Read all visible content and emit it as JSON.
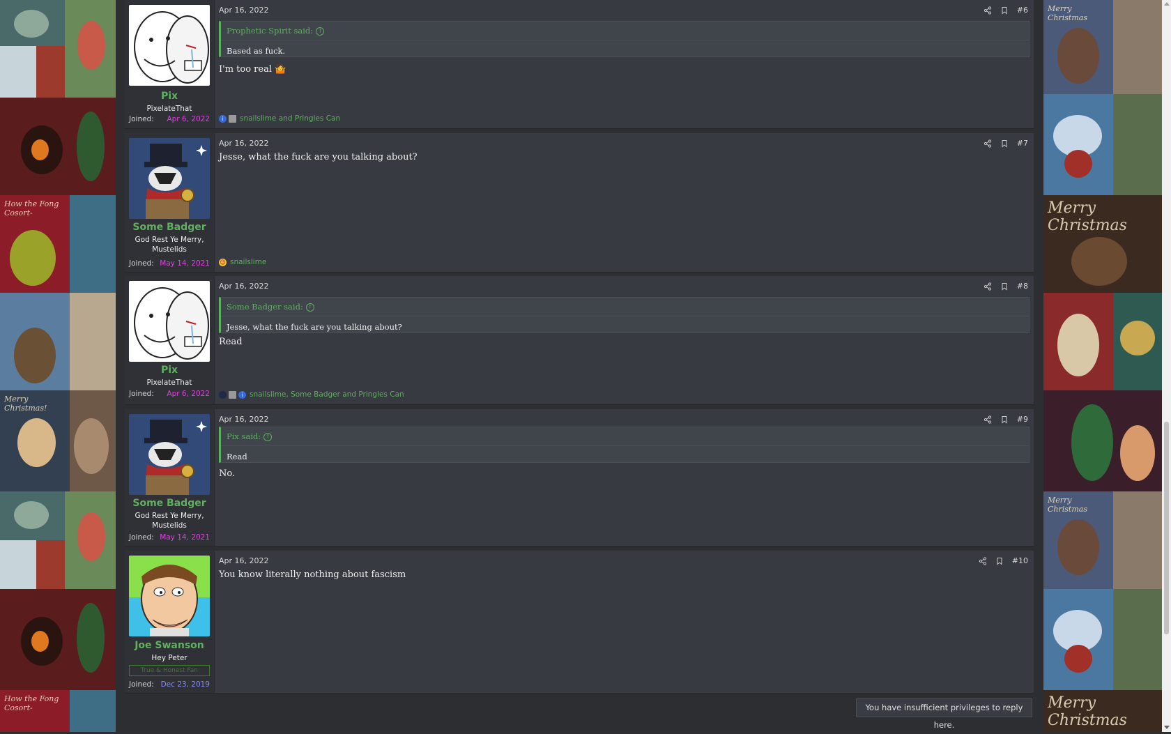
{
  "posts": [
    {
      "number": "#6",
      "date": "Apr 16, 2022",
      "user": {
        "name": "Pix",
        "title": "PixelateThat",
        "joined_label": "Joined:",
        "joined": "Apr 6, 2022",
        "joined_color": "#e040e0"
      },
      "quote": {
        "author": "Prophetic Spirit said:",
        "text": "Based as fuck."
      },
      "body": "I'm too real 🤷",
      "reactions": "snailslime and Pringles Can"
    },
    {
      "number": "#7",
      "date": "Apr 16, 2022",
      "user": {
        "name": "Some Badger",
        "title": "God Rest Ye Merry, Mustelids",
        "joined_label": "Joined:",
        "joined": "May 14, 2021",
        "joined_color": "#e040e0"
      },
      "body": "Jesse, what the fuck are you talking about?",
      "reactions": "snailslime"
    },
    {
      "number": "#8",
      "date": "Apr 16, 2022",
      "user": {
        "name": "Pix",
        "title": "PixelateThat",
        "joined_label": "Joined:",
        "joined": "Apr 6, 2022",
        "joined_color": "#e040e0"
      },
      "quote": {
        "author": "Some Badger said:",
        "text": "Jesse, what the fuck are you talking about?"
      },
      "body": "Read",
      "reactions": "snailslime, Some Badger and Pringles Can"
    },
    {
      "number": "#9",
      "date": "Apr 16, 2022",
      "user": {
        "name": "Some Badger",
        "title": "God Rest Ye Merry, Mustelids",
        "joined_label": "Joined:",
        "joined": "May 14, 2021",
        "joined_color": "#e040e0"
      },
      "quote": {
        "author": "Pix said:",
        "text": "Read"
      },
      "body": "No."
    },
    {
      "number": "#10",
      "date": "Apr 16, 2022",
      "user": {
        "name": "Joe Swanson",
        "title": "Hey Peter",
        "banner": "True & Honest Fan",
        "joined_label": "Joined:",
        "joined": "Dec 23, 2019",
        "joined_color": "#8a8aff"
      },
      "body": "You know literally nothing about fascism"
    }
  ],
  "reply_notice": "You have insufficient privileges to reply here.",
  "colors": {
    "accent": "#5fb05f",
    "background": "#2c2e32",
    "post": "#373a40"
  },
  "icons": {
    "share": "share-icon",
    "bookmark": "bookmark-icon",
    "quote_up": "arrow-up-circle-icon"
  }
}
